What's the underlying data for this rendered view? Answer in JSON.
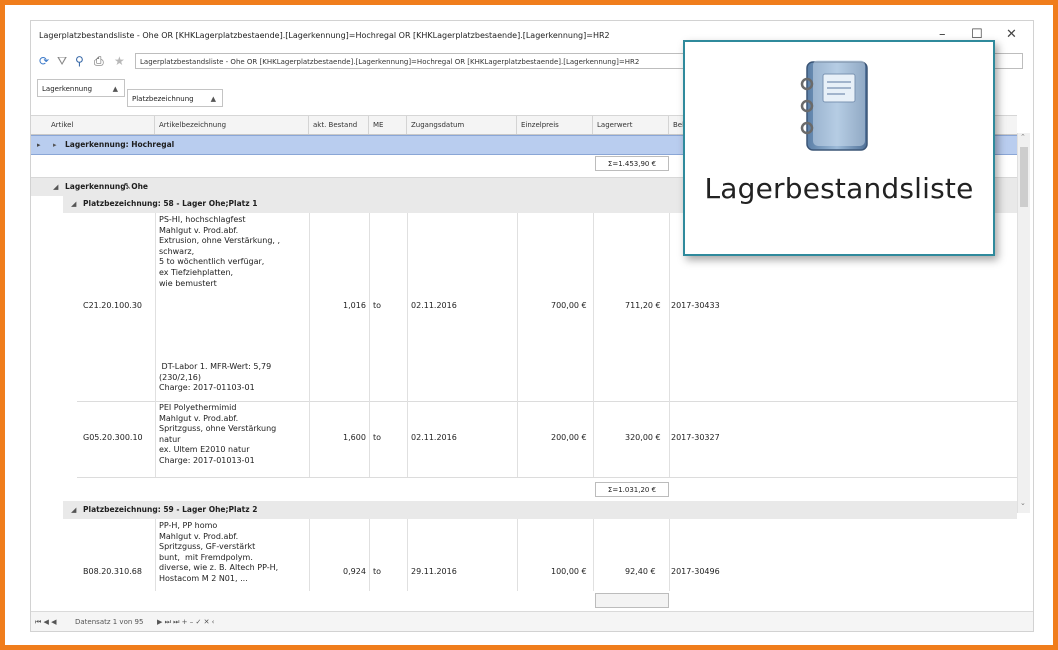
{
  "window": {
    "title": "Lagerplatzbestandsliste - Ohe OR [KHKLagerplatzbestaende].[Lagerkennung]=Hochregal OR [KHKLagerplatzbestaende].[Lagerkennung]=HR2",
    "controls": {
      "minimize": "–",
      "maximize": "☐",
      "close": "✕"
    }
  },
  "toolbar": {
    "address": "Lagerplatzbestandsliste - Ohe OR [KHKLagerplatzbestaende].[Lagerkennung]=Hochregal OR [KHKLagerplatzbestaende].[Lagerkennung]=HR2",
    "icons": [
      "refresh-icon",
      "filter-icon",
      "search-icon",
      "print-icon",
      "star-icon"
    ]
  },
  "group_panel": {
    "chip1": "Lagerkennung",
    "chip2": "Platzbezeichnung",
    "sort_arrow": "▲"
  },
  "columns": [
    "Artikel",
    "Artikelbezeichnung",
    "akt. Bestand",
    "ME",
    "Zugangsdatum",
    "Einzelpreis",
    "Lagerwert",
    "Bel"
  ],
  "groups": {
    "hochregal": {
      "label": "Lagerkennung: Hochregal",
      "sum": "Σ=1.453,90 €"
    },
    "ohe": {
      "label": "Lagerkennung: Ohe"
    },
    "platz1": {
      "label": "Platzbezeichnung: 58 - Lager Ohe;Platz 1",
      "sum": "Σ=1.031,20 €"
    },
    "platz2": {
      "label": "Platzbezeichnung: 59 - Lager Ohe;Platz 2"
    }
  },
  "rows": [
    {
      "artikel": "C21.20.100.30",
      "desc_top": "PS-HI, hochschlagfest\nMahlgut v. Prod.abf.\nExtrusion, ohne Verstärkung, ,\nschwarz,\n5 to wöchentlich verfügar,\nex Tiefziehplatten,\nwie bemustert",
      "desc_bottom": " DT-Labor 1. MFR-Wert: 5,79\n(230/2,16)\nCharge: 2017-01103-01",
      "bestand": "1,016",
      "me": "to",
      "datum": "02.11.2016",
      "preis": "700,00 €",
      "wert": "711,20 €",
      "beleg": "2017-30433"
    },
    {
      "artikel": "G05.20.300.10",
      "desc_top": "PEI Polyethermimid\nMahlgut v. Prod.abf.\nSpritzguss, ohne Verstärkung\nnatur\nex. Ultem E2010 natur\nCharge: 2017-01013-01",
      "bestand": "1,600",
      "me": "to",
      "datum": "02.11.2016",
      "preis": "200,00 €",
      "wert": "320,00 €",
      "beleg": "2017-30327"
    },
    {
      "artikel": "B08.20.310.68",
      "desc_top": "PP-H, PP homo\nMahlgut v. Prod.abf.\nSpritzguss, GF-verstärkt\nbunt,  mit Fremdpolym.\ndiverse, wie z. B. Altech PP-H,\nHostacom M 2 N01, ...",
      "bestand": "0,924",
      "me": "to",
      "datum": "29.11.2016",
      "preis": "100,00 €",
      "wert": "92,40 €",
      "beleg": "2017-30496"
    }
  ],
  "footer": {
    "record": "Datensatz 1 von 95",
    "nav": "⏮ ◀ ◀",
    "nav2": "▶ ⏭ ⏭ + – ✓ ✕ ‹"
  },
  "popup": {
    "label": "Lagerbestandsliste",
    "icon": "address-book-icon"
  },
  "colors": {
    "frame": "#f07d1c",
    "selected_group": "#b9cdef",
    "popup_border": "#2f8a9c"
  }
}
